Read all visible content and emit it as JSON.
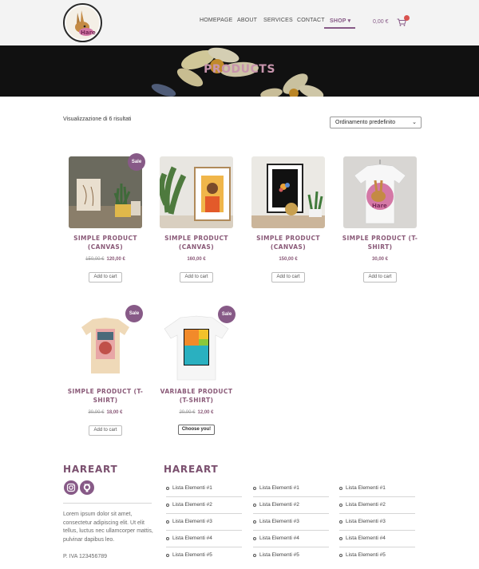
{
  "header": {
    "nav": {
      "homepage": "HOMEPAGE",
      "about": "ABOUT",
      "services": "SERVICES",
      "contact": "CONTACT",
      "shop": "SHOP"
    },
    "cart_total": "0,00 €"
  },
  "hero": {
    "title": "Products"
  },
  "shop": {
    "result_count": "Visualizzazione di 6 risultati",
    "ordering": "Ordinamento predefinito",
    "products": [
      {
        "name_line1": "SIMPLE PRODUCT",
        "name_line2": "(CANVAS)",
        "old_price": "150,00 €",
        "price": "120,00 €",
        "sale": "Sale",
        "button": "Add to cart"
      },
      {
        "name_line1": "SIMPLE PRODUCT",
        "name_line2": "(CANVAS)",
        "old_price": "",
        "price": "160,00 €",
        "sale": "",
        "button": "Add to cart"
      },
      {
        "name_line1": "SIMPLE PRODUCT",
        "name_line2": "(CANVAS)",
        "old_price": "",
        "price": "150,00 €",
        "sale": "",
        "button": "Add to cart"
      },
      {
        "name_line1": "SIMPLE PRODUCT (T-",
        "name_line2": "SHIRT)",
        "old_price": "",
        "price": "30,00 €",
        "sale": "",
        "button": "Add to cart"
      },
      {
        "name_line1": "SIMPLE PRODUCT (T-",
        "name_line2": "SHIRT)",
        "old_price": "30,00 €",
        "price": "18,00 €",
        "sale": "Sale",
        "button": "Add to cart"
      },
      {
        "name_line1": "VARIABLE PRODUCT",
        "name_line2": "(T-SHIRT)",
        "old_price": "20,00 €",
        "price": "12,00 €",
        "sale": "Sale",
        "button": "Choose you!"
      }
    ]
  },
  "footer": {
    "left_heading": "HAREART",
    "right_heading": "HAREART",
    "text": "Lorem ipsum dolor sit amet, consectetur adipiscing elit. Ut elit tellus, luctus nec ullamcorper mattis, pulvinar dapibus leo.",
    "vat": "P. IVA 123456789",
    "lists": [
      [
        "Lista Elementi #1",
        "Lista Elementi #2",
        "Lista Elementi #3",
        "Lista Elementi #4",
        "Lista Elementi #5"
      ],
      [
        "Lista Elementi #1",
        "Lista Elementi #2",
        "Lista Elementi #3",
        "Lista Elementi #4",
        "Lista Elementi #5"
      ],
      [
        "Lista Elementi #1",
        "Lista Elementi #2",
        "Lista Elementi #3",
        "Lista Elementi #4",
        "Lista Elementi #5"
      ]
    ]
  },
  "icons": [
    "hare-logo-icon",
    "cart-icon",
    "instagram-icon",
    "github-icon",
    "chevron-down-icon",
    "list-bullet-icon"
  ],
  "colors": {
    "accent": "#875a87",
    "heading": "#8a5a78",
    "hero_bg": "#111111",
    "header_bg": "#f3f3f3",
    "badge": "#d9534f"
  }
}
